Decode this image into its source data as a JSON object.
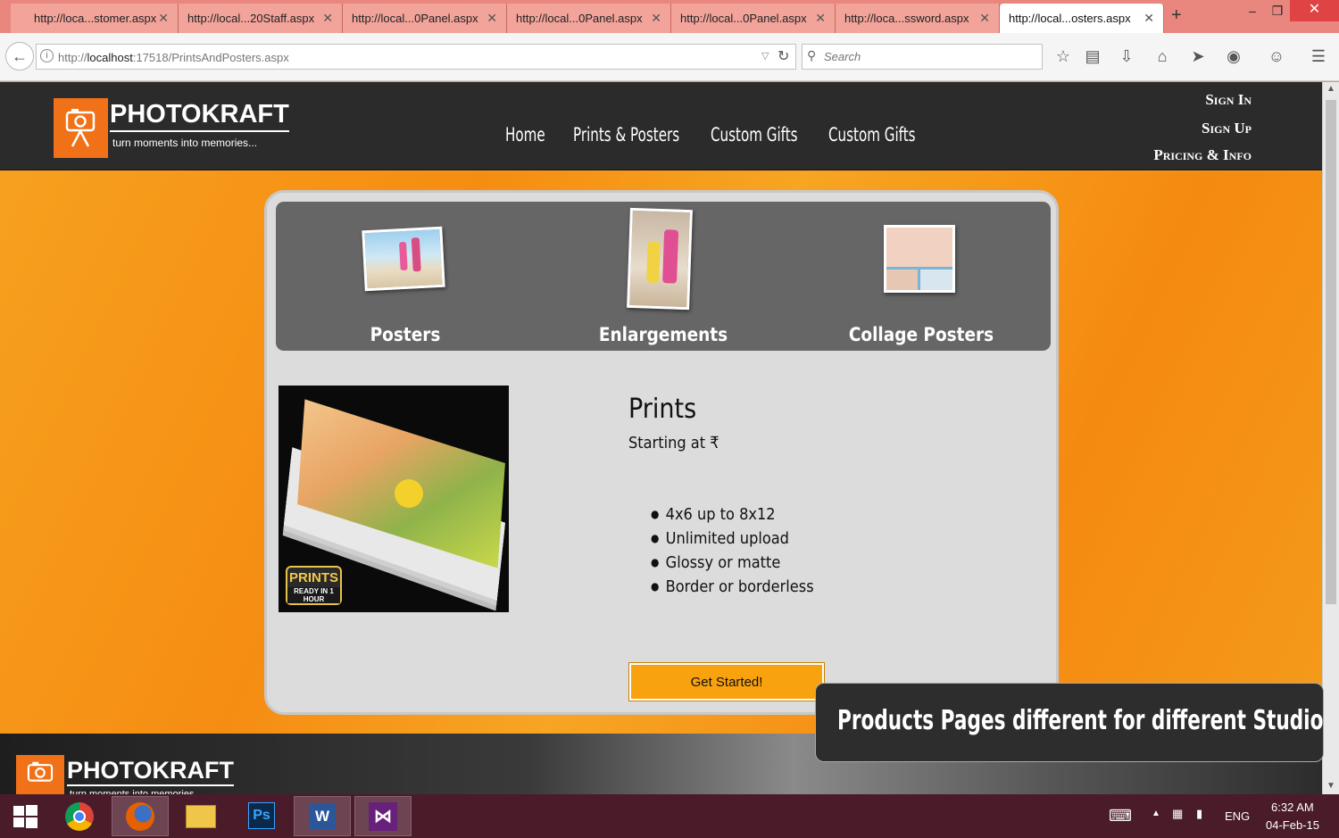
{
  "browser": {
    "tabs": [
      {
        "label": "http://loca...stomer.aspx",
        "active": false
      },
      {
        "label": "http://local...20Staff.aspx",
        "active": false
      },
      {
        "label": "http://local...0Panel.aspx",
        "active": false
      },
      {
        "label": "http://local...0Panel.aspx",
        "active": false
      },
      {
        "label": "http://local...0Panel.aspx",
        "active": false
      },
      {
        "label": "http://loca...ssword.aspx",
        "active": false
      },
      {
        "label": "http://local...osters.aspx",
        "active": true
      }
    ],
    "url_prefix": "http://",
    "url_host": "localhost",
    "url_path": ":17518/PrintsAndPosters.aspx",
    "search_placeholder": "Search",
    "new_tab": "+",
    "minimize": "–",
    "restore": "❐",
    "close": "✕"
  },
  "site": {
    "brand": "PHOTOKRAFT",
    "tagline": "turn moments into memories...",
    "nav": [
      "Home",
      "Prints & Posters",
      "Custom Gifts",
      "Custom Gifts"
    ],
    "account": [
      "Sign In",
      "Sign Up",
      "Pricing & Info"
    ],
    "accent_color": "#f07117"
  },
  "categories": [
    {
      "label": "Posters"
    },
    {
      "label": "Enlargements"
    },
    {
      "label": "Collage Posters"
    }
  ],
  "product": {
    "title": "Prints",
    "price_text": "Starting at ₹",
    "badge_line1": "PRINTS",
    "badge_line2": "READY IN 1 HOUR",
    "features": [
      "4x6 up to 8x12",
      "Unlimited upload",
      "Glossy or matte",
      "Border or borderless"
    ],
    "cta_label": "Get Started!"
  },
  "footer": {
    "brand": "PHOTOKRAFT",
    "tagline": "turn moments into memories..."
  },
  "caption": "Products Pages different for different Studios",
  "taskbar": {
    "language": "ENG",
    "time": "6:32 AM",
    "date": "04-Feb-15"
  }
}
